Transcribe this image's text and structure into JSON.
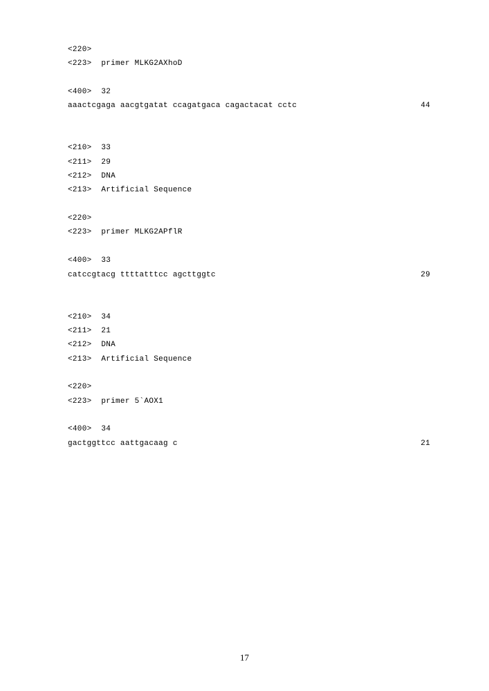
{
  "entries": [
    {
      "tags": [
        {
          "id": "<220>",
          "value": ""
        },
        {
          "id": "<223>",
          "value": "primer MLKG2AXhoD"
        }
      ],
      "blank_after_tags": true,
      "seq_id": "<400>",
      "seq_num": "32",
      "sequence": "aaactcgaga aacgtgatat ccagatgaca cagactacat cctc",
      "length": "44"
    },
    {
      "tags": [
        {
          "id": "<210>",
          "value": "33"
        },
        {
          "id": "<211>",
          "value": "29"
        },
        {
          "id": "<212>",
          "value": "DNA"
        },
        {
          "id": "<213>",
          "value": "Artificial Sequence"
        }
      ],
      "blank_after_tags": true,
      "extra_tags": [
        {
          "id": "<220>",
          "value": ""
        },
        {
          "id": "<223>",
          "value": "primer MLKG2APflR"
        }
      ],
      "blank_after_extra": true,
      "seq_id": "<400>",
      "seq_num": "33",
      "sequence": "catccgtacg ttttatttcc agcttggtc",
      "length": "29"
    },
    {
      "tags": [
        {
          "id": "<210>",
          "value": "34"
        },
        {
          "id": "<211>",
          "value": "21"
        },
        {
          "id": "<212>",
          "value": "DNA"
        },
        {
          "id": "<213>",
          "value": "Artificial Sequence"
        }
      ],
      "blank_after_tags": true,
      "extra_tags": [
        {
          "id": "<220>",
          "value": ""
        },
        {
          "id": "<223>",
          "value": "primer 5`AOX1"
        }
      ],
      "blank_after_extra": true,
      "seq_id": "<400>",
      "seq_num": "34",
      "sequence": "gactggttcc aattgacaag c",
      "length": "21"
    }
  ],
  "page_number": "17"
}
